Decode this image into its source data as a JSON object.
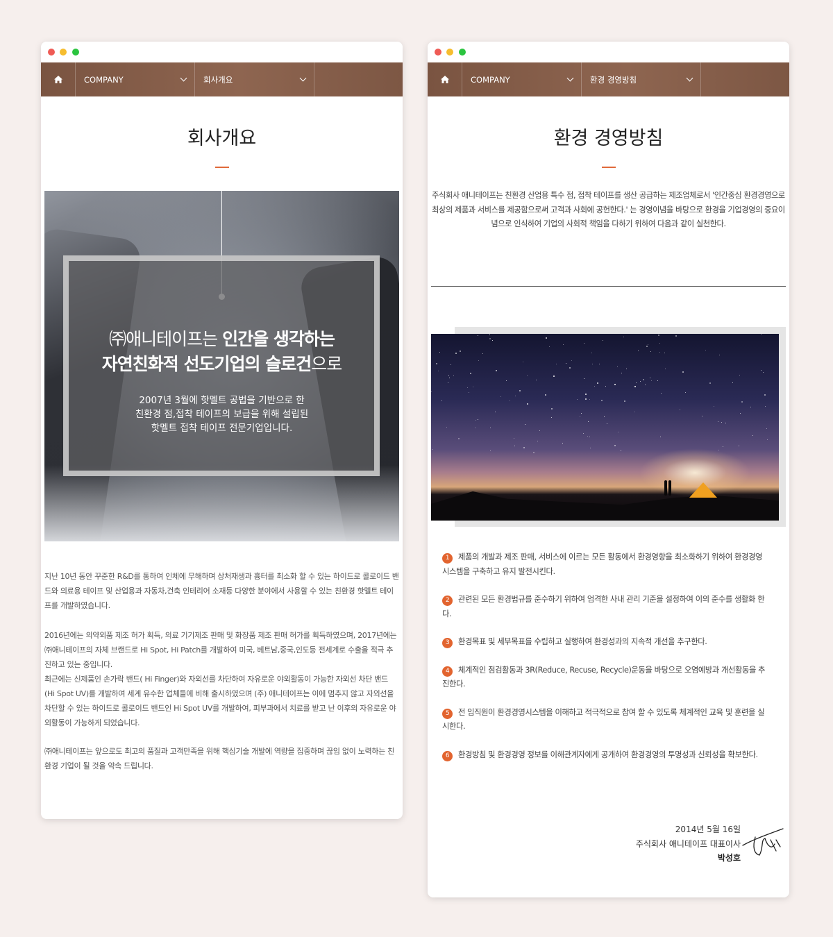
{
  "left": {
    "nav": {
      "home_icon": "home-icon",
      "menu1": "COMPANY",
      "menu2": "회사개요"
    },
    "title": "회사개요",
    "hero": {
      "line1_plain": "㈜애니테이프는 ",
      "line1_bold": "인간을 생각하는",
      "line2_bold": "자연친화적 선도기업의 슬로건",
      "line2_plain": "으로",
      "sub1": "2007년 3월에 핫멜트 공법을 기반으로 한",
      "sub2": "친환경 점,접착 테이프의 보급을 위해 설립된",
      "sub3": "핫멜트 접착 테이프 전문기업입니다."
    },
    "para1": "지난 10년 동안 꾸준한 R&D를 통하여 인체에 무해하며 상처재생과 흉터를 최소화 할 수 있는 하이드로 콜로이드 밴드와 의료용 테이프 및 산업용과 자동차,건축 인테리어 소재등 다양한 분야에서 사용할 수 있는 친환경 핫멜트 테이프를 개발하였습니다.",
    "para2a": "2016년에는 의약외품 제조 허가 획득, 의료 기기제조 판매 및 화장품 제조 판매 허가를 획득하였으며, 2017년에는 ㈜애니테이프의 자체 브랜드로 Hi Spot, Hi Patch를 개발하여 미국, 베트남,중국,인도등 전세계로 수출을 적극 추진하고 있는 중입니다.",
    "para2b": "최근에는 신제품인 손가락 밴드( Hi Finger)와 자외선를 차단하여 자유로운 야외활동이 가능한 자외선 차단 밴드 (Hi Spot UV)를 개발하여 세계 유수한 업체들에 비해 출시하였으며 (주) 애니테이프는 이에 멈추지 않고 자외선을 차단할 수 있는 하이드로 콜로이드 밴드인 Hi Spot UV를 개발하여, 피부과에서 치료를 받고 난 이후의 자유로운 야외활동이 가능하게 되었습니다.",
    "para3": "㈜애니테이프는 앞으로도 최고의 품질과 고객만족을 위해 핵심기술 개발에 역량을 집중하며 끊임 없이 노력하는 친환경 기업이 될 것을 약속 드립니다."
  },
  "right": {
    "nav": {
      "home_icon": "home-icon",
      "menu1": "COMPANY",
      "menu2": "환경 경영방침"
    },
    "title": "환경 경영방침",
    "intro": "주식회사 애니테이프는 친환경 산업용 특수 점, 접착 테이프를 생산 공급하는 제조업체로서 '인간중심 환경경영으로 최상의 제품과 서비스를 제공함으로써 고객과 사회에 공헌한다.' 는 경영이념을 바탕으로 환경을 기업경영의 중요이념으로 인식하여 기업의 사회적 책임을 다하기 위하여 다음과 같이 실천한다.",
    "items": [
      {
        "n": "1",
        "text": "제품의 개발과 제조 판매, 서비스에 이르는 모든 활동에서 환경영향을 최소화하기 위하여 환경경영시스템을 구축하고 유지 발전시킨다."
      },
      {
        "n": "2",
        "text": "관련된 모든 환경법규를 준수하기 위하여 엄격한 사내 관리 기준을 설정하여 이의 준수를 생활화 한다."
      },
      {
        "n": "3",
        "text": "환경목표 및 세부목표를 수립하고 실행하여 환경성과의 지속적 개선을 추구한다."
      },
      {
        "n": "4",
        "text": "체계적인 점검활동과 3R(Reduce, Recuse, Recycle)운동을 바탕으로 오염예방과 개선활동을 추진한다."
      },
      {
        "n": "5",
        "text": "전 임직원이 환경경영시스템을 이해하고 적극적으로 참여 할 수 있도록 체계적인 교육 및 훈련을 실시한다."
      },
      {
        "n": "6",
        "text": "환경방침 및 환경경영 정보를 이해관계자에게 공개하여 환경경영의 투명성과 신뢰성을 확보한다."
      }
    ],
    "date": "2014년 5월 16일",
    "company": "주식회사 애니테이프 대표이사",
    "ceo": "박성호"
  },
  "colors": {
    "nav": "#7d5744",
    "accent": "#e2642f"
  }
}
